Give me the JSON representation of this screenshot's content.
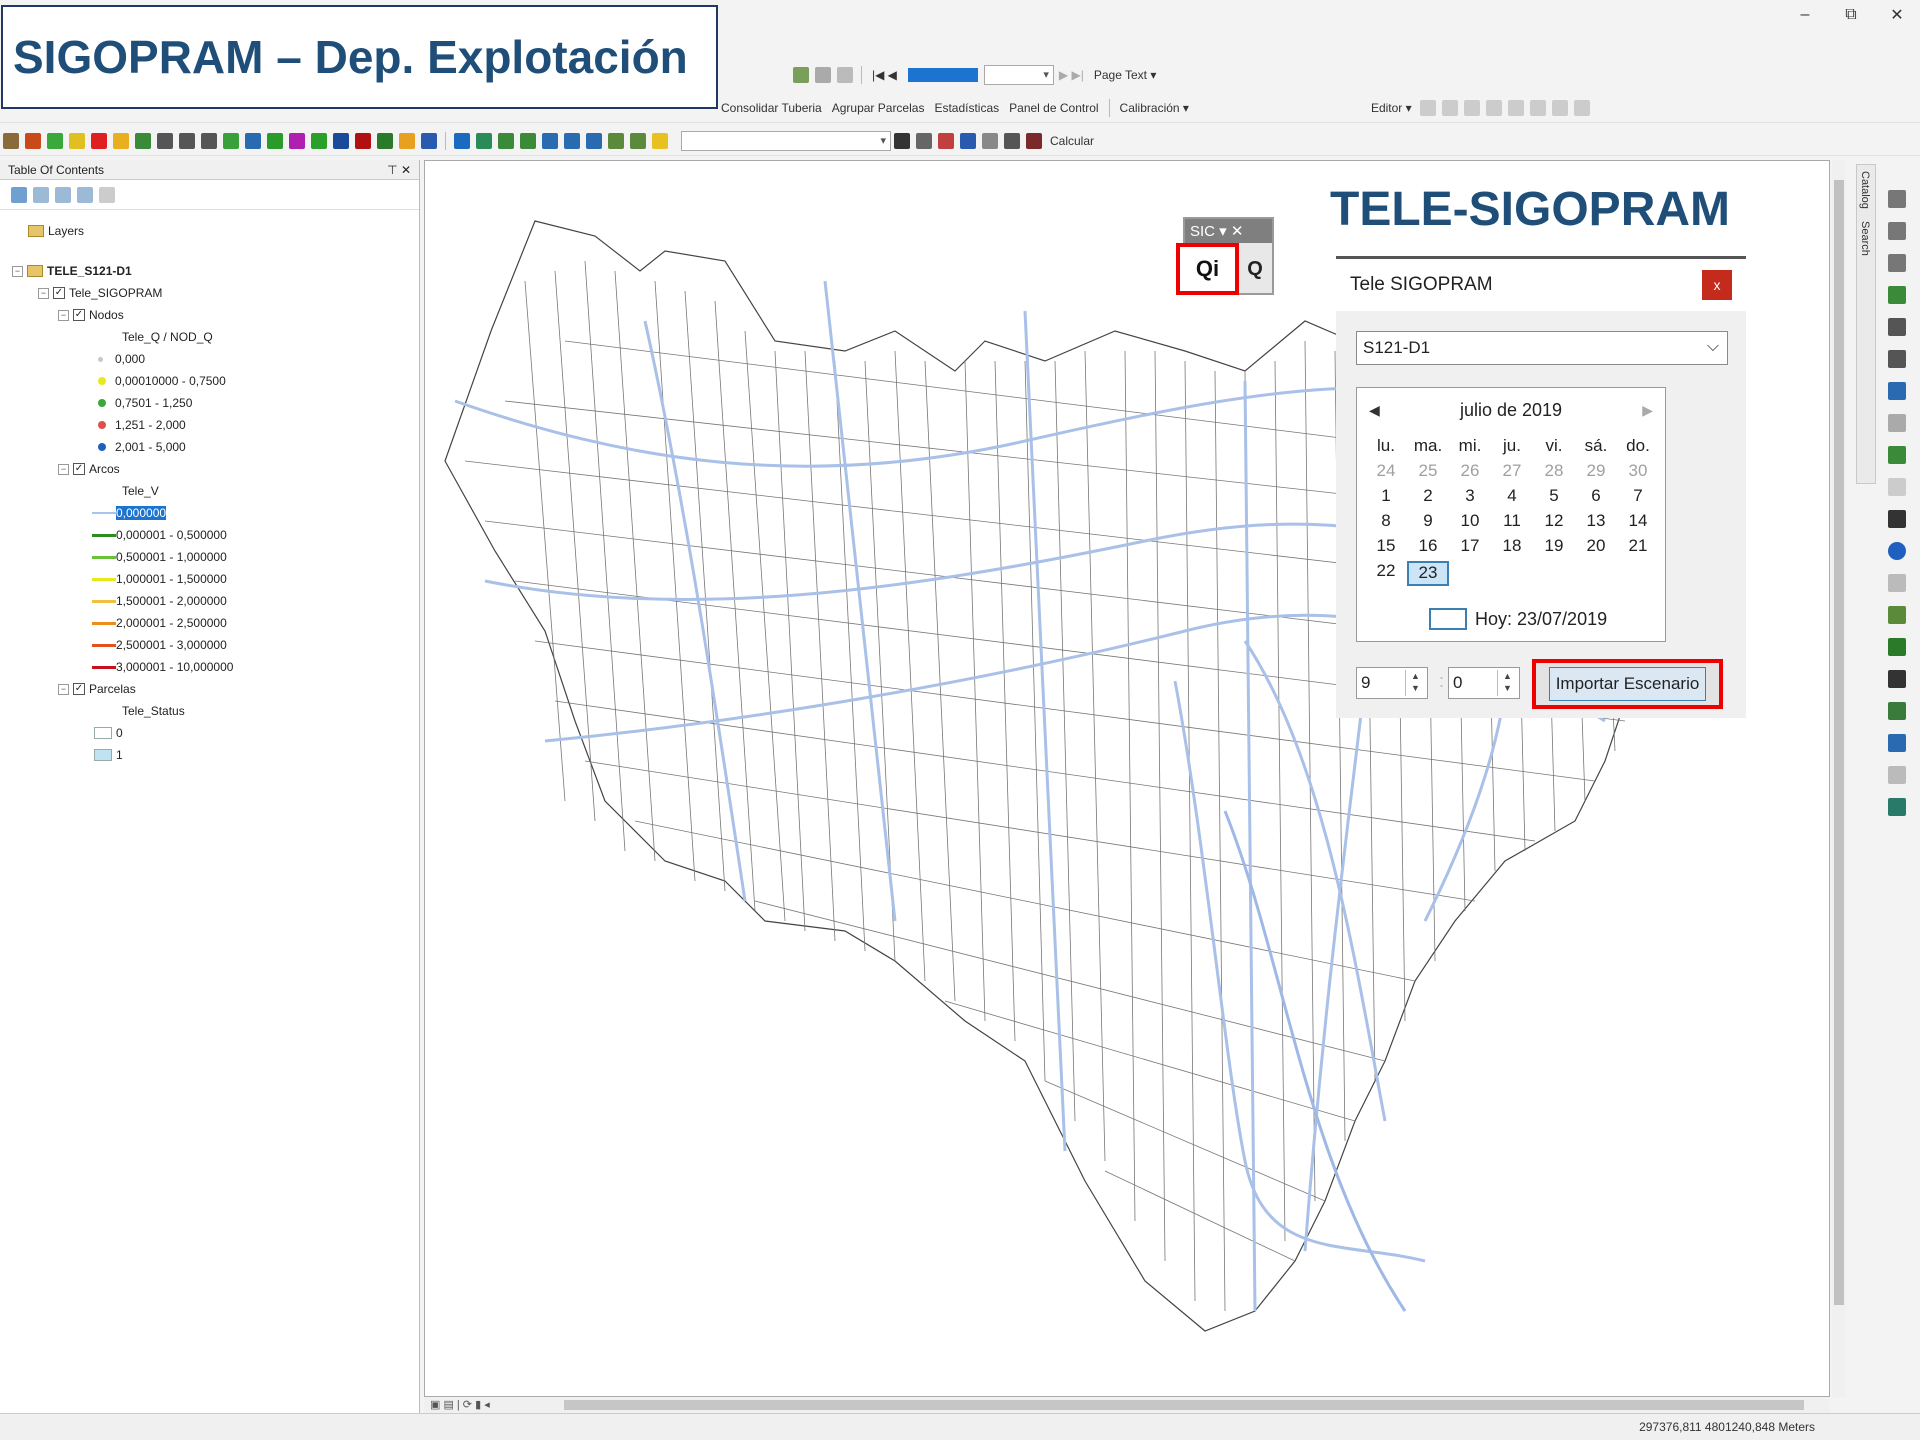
{
  "slide_title": "SIGOPRAM – Dep. Explotación",
  "window_controls": {
    "minimize": "–",
    "restore": "⧉",
    "close": "✕"
  },
  "toolbar1": {
    "page_text": "Page Text ▾"
  },
  "toolbar2": {
    "items": [
      "Consolidar Tuberia",
      "Agrupar Parcelas",
      "Estadísticas",
      "Panel de Control",
      "Calibración ▾"
    ],
    "editor": "Editor ▾"
  },
  "toolbar3": {
    "calcular": "Calcular"
  },
  "toc": {
    "title": "Table Of Contents",
    "pin": "⊤ ✕",
    "layers_label": "Layers",
    "group": "TELE_S121-D1",
    "sublayer": "Tele_SIGOPRAM",
    "nodos": {
      "label": "Nodos",
      "field": "Tele_Q / NOD_Q",
      "classes": [
        {
          "label": "0,000",
          "color": "#c8c8c8"
        },
        {
          "label": "0,00010000 - 0,7500",
          "color": "#e8e820"
        },
        {
          "label": "0,7501 - 1,250",
          "color": "#3aa83a"
        },
        {
          "label": "1,251 - 2,000",
          "color": "#e0504a"
        },
        {
          "label": "2,001 - 5,000",
          "color": "#1f5fbf"
        }
      ]
    },
    "arcos": {
      "label": "Arcos",
      "field": "Tele_V",
      "classes": [
        {
          "label": "0,000000",
          "color": "#a9c4ef",
          "selected": true
        },
        {
          "label": "0,000001 - 0,500000",
          "color": "#2e8b22"
        },
        {
          "label": "0,500001 - 1,000000",
          "color": "#6ac23a"
        },
        {
          "label": "1,000001 - 1,500000",
          "color": "#e8e81a"
        },
        {
          "label": "1,500001 - 2,000000",
          "color": "#f0c040"
        },
        {
          "label": "2,000001 - 2,500000",
          "color": "#f08a1a"
        },
        {
          "label": "2,500001 - 3,000000",
          "color": "#e8501a"
        },
        {
          "label": "3,000001 - 10,000000",
          "color": "#c8101a"
        }
      ]
    },
    "parcelas": {
      "label": "Parcelas",
      "field": "Tele_Status",
      "classes": [
        {
          "label": "0",
          "color": "#ffffff"
        },
        {
          "label": "1",
          "color": "#bfe3f2"
        }
      ]
    }
  },
  "sig_toolbar": {
    "title": "SIC ▾ ✕",
    "qi": "Qi",
    "q2": "Q"
  },
  "tele_title": "TELE-SIGOPRAM",
  "dialog": {
    "title": "Tele SIGOPRAM",
    "close": "x",
    "scenario": "S121-D1",
    "calendar": {
      "month": "julio de 2019",
      "dow": [
        "lu.",
        "ma.",
        "mi.",
        "ju.",
        "vi.",
        "sá.",
        "do."
      ],
      "prev_days": [
        "24",
        "25",
        "26",
        "27",
        "28",
        "29",
        "30"
      ],
      "days": [
        "1",
        "2",
        "3",
        "4",
        "5",
        "6",
        "7",
        "8",
        "9",
        "10",
        "11",
        "12",
        "13",
        "14",
        "15",
        "16",
        "17",
        "18",
        "19",
        "20",
        "21",
        "22",
        "23"
      ],
      "selected": "23",
      "today": "Hoy: 23/07/2019"
    },
    "hour": "9",
    "minute": "0",
    "import_button": "Importar Escenario"
  },
  "rail_tabs": [
    "Catalog",
    "Search"
  ],
  "status": {
    "coords": "297376,811  4801240,848 Meters"
  }
}
